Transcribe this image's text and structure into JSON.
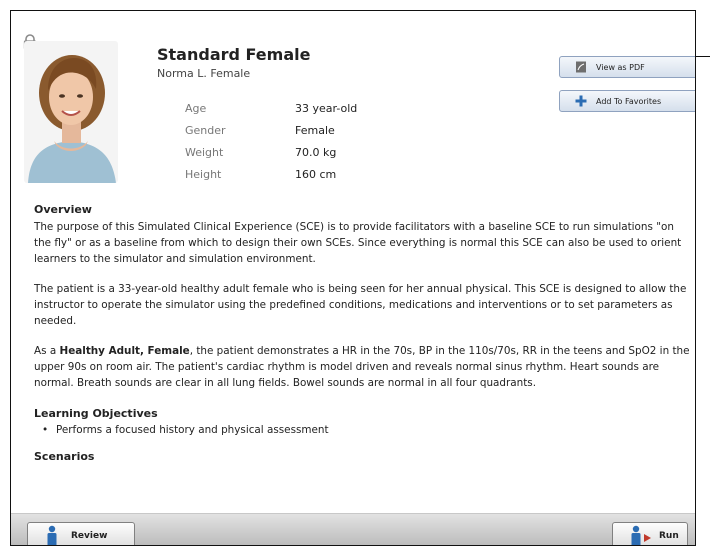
{
  "header": {
    "title": "Standard Female",
    "subtitle": "Norma L. Female"
  },
  "attributes": [
    {
      "label": "Age",
      "value": "33 year-old"
    },
    {
      "label": "Gender",
      "value": "Female"
    },
    {
      "label": "Weight",
      "value": "70.0 kg"
    },
    {
      "label": "Height",
      "value": "160 cm"
    }
  ],
  "actions": {
    "view_pdf": "View as PDF",
    "add_favorites": "Add To Favorites"
  },
  "overview": {
    "heading": "Overview",
    "p1": "The purpose of this Simulated Clinical Experience (SCE) is to provide facilitators with a baseline SCE to run simulations \"on the fly\" or as a baseline from which to design their own SCEs. Since everything is normal this SCE can also be used to orient learners to the simulator and simulation environment.",
    "p2": "The patient is a 33-year-old healthy adult female who is being seen for her annual physical. This SCE is designed to allow the instructor to operate the simulator using the predefined conditions, medications and interventions or to set parameters as needed.",
    "p3_prefix": "As a ",
    "p3_bold": "Healthy Adult, Female",
    "p3_rest": ", the patient demonstrates a HR in the 70s, BP in the 110s/70s, RR in the teens and SpO2 in the upper 90s on room air. The patient's cardiac rhythm is model driven and reveals normal sinus rhythm. Heart sounds are normal. Breath sounds are clear in all lung fields. Bowel sounds are normal in all four quadrants."
  },
  "learning": {
    "heading": "Learning Objectives",
    "items": [
      "Performs a focused history and physical assessment"
    ]
  },
  "scenarios": {
    "heading": "Scenarios"
  },
  "bottom": {
    "review": "Review",
    "run": "Run"
  },
  "icons": {
    "lock": "lock-icon",
    "pdf": "pdf-icon",
    "favorites": "plus-icon",
    "review": "patient-figure-icon",
    "run": "patient-run-icon"
  },
  "colors": {
    "accent_blue": "#2b6cb3",
    "run_arrow": "#c0392b"
  }
}
